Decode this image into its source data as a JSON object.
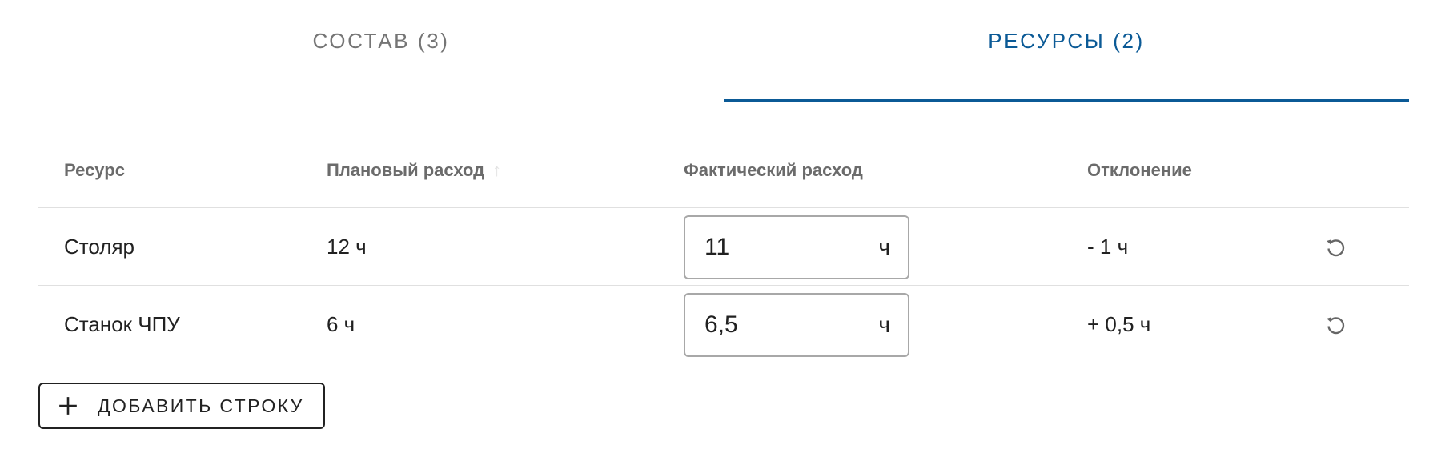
{
  "tabs": [
    {
      "label": "Состав (3)",
      "active": false
    },
    {
      "label": "Ресурсы (2)",
      "active": true
    }
  ],
  "table": {
    "columns": {
      "resource": "Ресурс",
      "planned": "Плановый расход",
      "actual": "Фактический расход",
      "deviation": "Отклонение"
    },
    "sort_icon": "arrow-up-icon",
    "rows": [
      {
        "resource": "Столяр",
        "planned": "12 ч",
        "actual_value": "11",
        "actual_unit": "ч",
        "deviation": "- 1 ч"
      },
      {
        "resource": "Станок ЧПУ",
        "planned": "6 ч",
        "actual_value": "6,5",
        "actual_unit": "ч",
        "deviation": "+ 0,5 ч"
      }
    ]
  },
  "add_button": {
    "label": "Добавить строку",
    "icon": "plus-icon"
  },
  "colors": {
    "accent": "#0b5a96",
    "inactive_tab": "#757575",
    "header_text": "#6b6b6b",
    "border": "#e0e0e0"
  }
}
